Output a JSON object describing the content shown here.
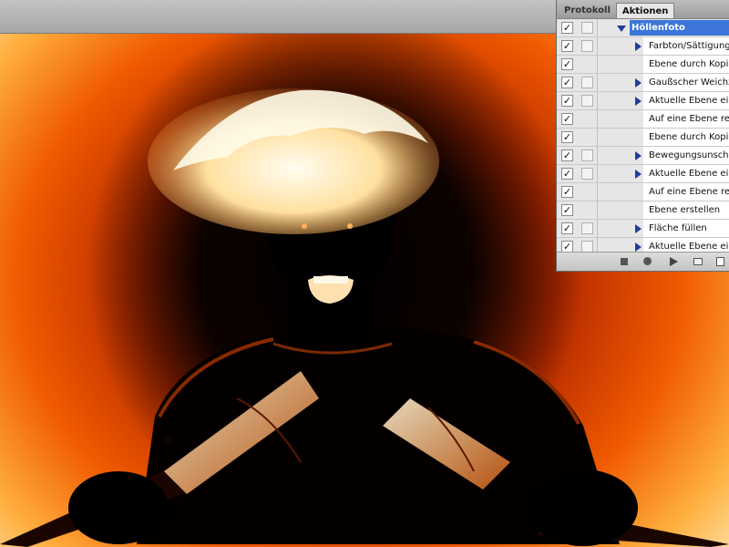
{
  "panel": {
    "tabs": [
      {
        "label": "Protokoll",
        "active": false
      },
      {
        "label": "Aktionen",
        "active": true
      }
    ],
    "action_set": {
      "label": "Höllenfoto",
      "checked": true,
      "expanded": true
    },
    "actions": [
      {
        "label": "Farbton/Sättigung",
        "checked": true,
        "has_dialog": true,
        "expandable": true
      },
      {
        "label": "Ebene durch Kopie",
        "checked": true,
        "has_dialog": false,
        "expandable": false
      },
      {
        "label": "Gaußscher Weichzeichner",
        "checked": true,
        "has_dialog": true,
        "expandable": true
      },
      {
        "label": "Aktuelle Ebene einstellen",
        "checked": true,
        "has_dialog": true,
        "expandable": true
      },
      {
        "label": "Auf eine Ebene reduzieren",
        "checked": true,
        "has_dialog": false,
        "expandable": false
      },
      {
        "label": "Ebene durch Kopie",
        "checked": true,
        "has_dialog": false,
        "expandable": false
      },
      {
        "label": "Bewegungsunschärfe",
        "checked": true,
        "has_dialog": true,
        "expandable": true
      },
      {
        "label": "Aktuelle Ebene einstellen",
        "checked": true,
        "has_dialog": true,
        "expandable": true
      },
      {
        "label": "Auf eine Ebene reduzieren",
        "checked": true,
        "has_dialog": false,
        "expandable": false
      },
      {
        "label": "Ebene erstellen",
        "checked": true,
        "has_dialog": false,
        "expandable": false
      },
      {
        "label": "Fläche füllen",
        "checked": true,
        "has_dialog": true,
        "expandable": true
      },
      {
        "label": "Aktuelle Ebene einstellen",
        "checked": true,
        "has_dialog": true,
        "expandable": true
      }
    ],
    "footer_icons": [
      "stop-icon",
      "record-icon",
      "play-icon",
      "new-set-icon",
      "new-action-icon"
    ]
  },
  "canvas": {
    "cursor_icon": "crop-cursor-icon",
    "colors": {
      "glow_outer": "#ffe6b0",
      "glow_mid": "#f05a00",
      "glow_inner": "#b32800",
      "figure": "#000000"
    }
  }
}
